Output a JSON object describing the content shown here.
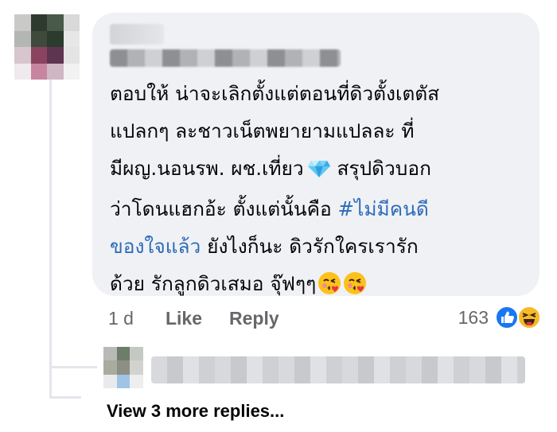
{
  "comment": {
    "text_lines": [
      "ตอบให้ น่าจะเลิกตั้งแต่ตอนที่ดิวตั้งเตตัส",
      "แปลกๆ ละชาวเน็ตพยายามแปลละ ที่",
      "มีผญ.นอนรพ. ผช.เที่ยว",
      " สรุปดิวบอก",
      "ว่าโดนแฮกอ้ะ ตั้งแต่นั้นคือ ",
      "#ไม่มีคนดี",
      "ของใจแล้ว",
      " ยังไงก็นะ ดิวรักใครเรารัก",
      "ด้วย รักลูกดิวเสมอ จุ๊ฟๆๆ"
    ],
    "emoji": {
      "gem": "gem-icon",
      "kiss": "face-blowing-kiss-icon"
    },
    "hashtag_color": "#2d6bb8"
  },
  "actions": {
    "time": "1 d",
    "like_label": "Like",
    "reply_label": "Reply"
  },
  "reactions": {
    "count": "163",
    "icons": [
      "like-icon",
      "haha-icon"
    ],
    "like_color": "#1877f2",
    "haha_color": "#f7b928"
  },
  "replies": {
    "more_label": "View 3 more replies..."
  }
}
